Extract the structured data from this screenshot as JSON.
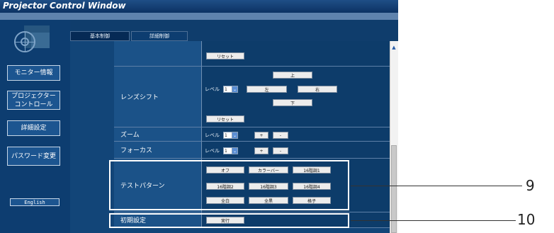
{
  "window": {
    "title": "Projector Control Window"
  },
  "tabs": [
    {
      "label": "基本制御"
    },
    {
      "label": "詳細制御"
    }
  ],
  "sidebar": {
    "items": [
      {
        "label": "モニター情報"
      },
      {
        "label": "プロジェクター\nコントロール"
      },
      {
        "label": "詳細設定"
      },
      {
        "label": "パスワード変更"
      }
    ],
    "language_button": "English"
  },
  "rows": {
    "reset_top": {
      "button": "リセット"
    },
    "lens_shift": {
      "label": "レンズシフト",
      "level_label": "レベル",
      "level_value": "1",
      "up": "上",
      "left": "左",
      "right": "右",
      "down": "下",
      "reset": "リセット"
    },
    "zoom": {
      "label": "ズーム",
      "level_label": "レベル",
      "level_value": "1",
      "plus": "+",
      "minus": "-"
    },
    "focus": {
      "label": "フォーカス",
      "level_label": "レベル",
      "level_value": "1",
      "plus": "+",
      "minus": "-"
    },
    "test_pattern": {
      "label": "テストパターン",
      "buttons": [
        "オフ",
        "カラーバー",
        "16階調1",
        "16階調2",
        "16階調3",
        "16階調4",
        "全白",
        "全黒",
        "格子"
      ]
    },
    "initial_settings": {
      "label": "初期設定",
      "button": "実行"
    }
  },
  "callouts": [
    "9",
    "10"
  ],
  "colors": {
    "accent": "#1c5590",
    "background": "#124578",
    "title": "#1f4f86"
  }
}
